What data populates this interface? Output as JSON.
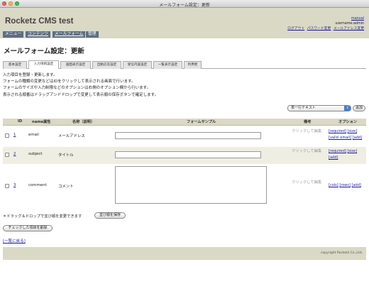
{
  "window": {
    "title": "メールフォーム設定：更新"
  },
  "header": {
    "brand": "Rocketz CMS test",
    "user_name": "manual",
    "username_line": "username:admin",
    "links": [
      "ログアウト",
      "パスワード変更",
      "メールアドレス変更"
    ]
  },
  "menu": [
    "メニュー",
    "コンテンツ",
    "メールフォーム",
    "管理"
  ],
  "page_title": "メールフォーム設定：更新",
  "tabs": [
    "基本設定",
    "入力項目設定",
    "画面表示設定",
    "自動応答設定",
    "受信内容設定",
    "一覧表示設定",
    "利用者"
  ],
  "active_tab": 1,
  "description": [
    "入力項目を登録・更新します。",
    "フォームの種類の変更などはIDをクリックして表示される画面で行います。",
    "フォームのサイズや入力制限などのオプションは右側のオプション欄から行います。",
    "表示される順番はドラッグアンドドロップで変更して表示順の保存ボタンで確定します。"
  ],
  "type_select": {
    "value": "単一行テキスト"
  },
  "add_button": "追加",
  "table": {
    "headers": {
      "id": "ID",
      "name": "name属性",
      "label": "名称（説明）",
      "sample": "フォームサンプル",
      "note": "備考",
      "options": "オプション"
    },
    "rows": [
      {
        "id": "1",
        "name": "email",
        "label": "メールアドレス",
        "note": "クリックして編集",
        "options": [
          "[required]",
          "[size]",
          "[valid_email]",
          "[add]"
        ]
      },
      {
        "id": "2",
        "name": "subject",
        "label": "タイトル",
        "note": "クリックして編集",
        "options": [
          "[required]",
          "[size]",
          "[add]"
        ]
      },
      {
        "id": "3",
        "name": "comment",
        "label": "コメント",
        "note": "クリックして編集",
        "options": [
          "[cols]",
          "[rows]",
          "[add]"
        ]
      }
    ]
  },
  "drag_note": "＊ドラッグ＆ドロップで並び順を変更できます",
  "save_order_button": "並び順を保存",
  "delete_checked_button": "チェックした項目を削除",
  "back_link": "[一覧に戻る]",
  "footer": {
    "copyright": "copyright Rocketz Co.,Ltd."
  },
  "colors": {
    "header_bg": "#d9d9c5",
    "menu_item_bg": "#5d6f83",
    "link": "#1a1aa6"
  }
}
